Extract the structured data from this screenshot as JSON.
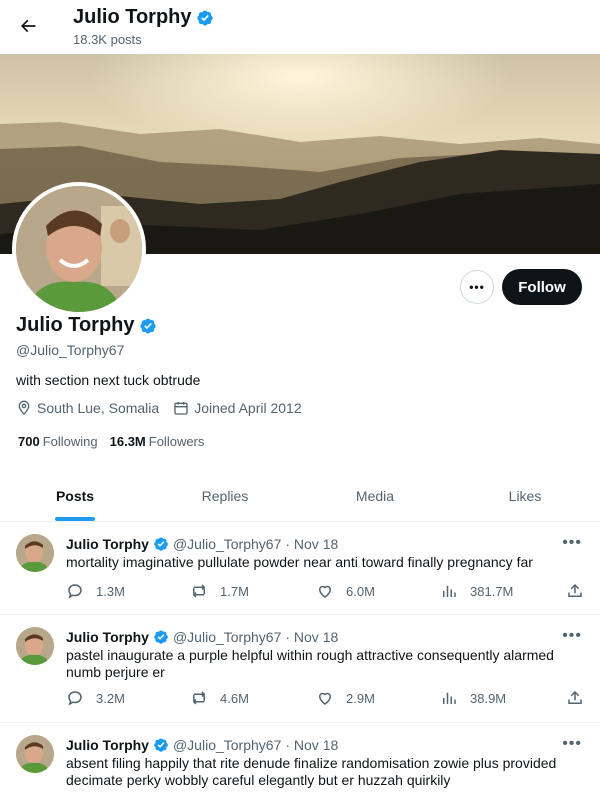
{
  "header": {
    "name": "Julio Torphy",
    "posts_count": "18.3K posts"
  },
  "profile": {
    "name": "Julio Torphy",
    "handle": "@Julio_Torphy67",
    "bio": "with section next tuck obtrude",
    "location": "South Lue, Somalia",
    "joined": "Joined April 2012",
    "following_count": "700",
    "following_label": "Following",
    "followers_count": "16.3M",
    "followers_label": "Followers",
    "follow_label": "Follow",
    "more_label": "•••"
  },
  "tabs": [
    {
      "label": "Posts",
      "active": true
    },
    {
      "label": "Replies"
    },
    {
      "label": "Media"
    },
    {
      "label": "Likes"
    }
  ],
  "posts": [
    {
      "name": "Julio Torphy",
      "handle": "@Julio_Torphy67",
      "date": "· Nov 18",
      "text": "mortality imaginative pullulate powder near anti toward finally pregnancy far",
      "replies": "1.3M",
      "reposts": "1.7M",
      "likes": "6.0M",
      "views": "381.7M",
      "more": "•••"
    },
    {
      "name": "Julio Torphy",
      "handle": "@Julio_Torphy67",
      "date": "· Nov 18",
      "text": "pastel inaugurate a purple helpful within rough attractive consequently alarmed numb perjure er",
      "replies": "3.2M",
      "reposts": "4.6M",
      "likes": "2.9M",
      "views": "38.9M",
      "more": "•••"
    },
    {
      "name": "Julio Torphy",
      "handle": "@Julio_Torphy67",
      "date": "· Nov 18",
      "text": "absent filing happily that rite denude finalize randomisation zowie plus provided decimate perky wobbly careful elegantly but er huzzah quirkily",
      "more": "•••"
    }
  ],
  "colors": {
    "accent": "#1d9bf0",
    "text": "#0f1419",
    "muted": "#536471",
    "button_dark": "#0f1419"
  }
}
